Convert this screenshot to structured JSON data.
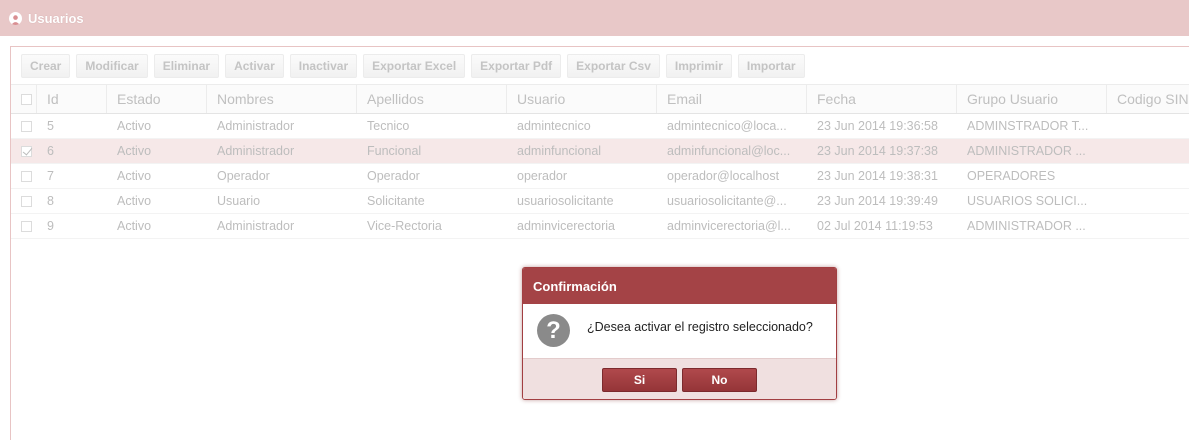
{
  "window": {
    "title": "Usuarios",
    "icon": "user-icon"
  },
  "toolbar": {
    "buttons": [
      "Crear",
      "Modificar",
      "Eliminar",
      "Activar",
      "Inactivar",
      "Exportar Excel",
      "Exportar Pdf",
      "Exportar Csv",
      "Imprimir",
      "Importar"
    ]
  },
  "table": {
    "columns": [
      "Id",
      "Estado",
      "Nombres",
      "Apellidos",
      "Usuario",
      "Email",
      "Fecha",
      "Grupo Usuario",
      "Codigo SIN"
    ],
    "rows": [
      {
        "selected": false,
        "cells": [
          "5",
          "Activo",
          "Administrador",
          "Tecnico",
          "admintecnico",
          "admintecnico@loca...",
          "23 Jun 2014 19:36:58",
          "ADMINSTRADOR T..."
        ]
      },
      {
        "selected": true,
        "cells": [
          "6",
          "Activo",
          "Administrador",
          "Funcional",
          "adminfuncional",
          "adminfuncional@loc...",
          "23 Jun 2014 19:37:38",
          "ADMINISTRADOR ..."
        ]
      },
      {
        "selected": false,
        "cells": [
          "7",
          "Activo",
          "Operador",
          "Operador",
          "operador",
          "operador@localhost",
          "23 Jun 2014 19:38:31",
          "OPERADORES"
        ]
      },
      {
        "selected": false,
        "cells": [
          "8",
          "Activo",
          "Usuario",
          "Solicitante",
          "usuariosolicitante",
          "usuariosolicitante@...",
          "23 Jun 2014 19:39:49",
          "USUARIOS SOLICI..."
        ]
      },
      {
        "selected": false,
        "cells": [
          "9",
          "Activo",
          "Administrador",
          "Vice-Rectoria",
          "adminvicerectoria",
          "adminvicerectoria@l...",
          "02 Jul 2014 11:19:53",
          "ADMINISTRADOR ..."
        ]
      }
    ]
  },
  "dialog": {
    "title": "Confirmación",
    "message": "¿Desea activar el registro seleccionado?",
    "icon": "question-icon",
    "icon_glyph": "?",
    "yes_label": "Si",
    "no_label": "No"
  },
  "colors": {
    "title_bar": "#e8c8c8",
    "dialog_header": "#a44346",
    "dialog_button": "#a23f42",
    "selected_row": "#f6e8e8"
  }
}
